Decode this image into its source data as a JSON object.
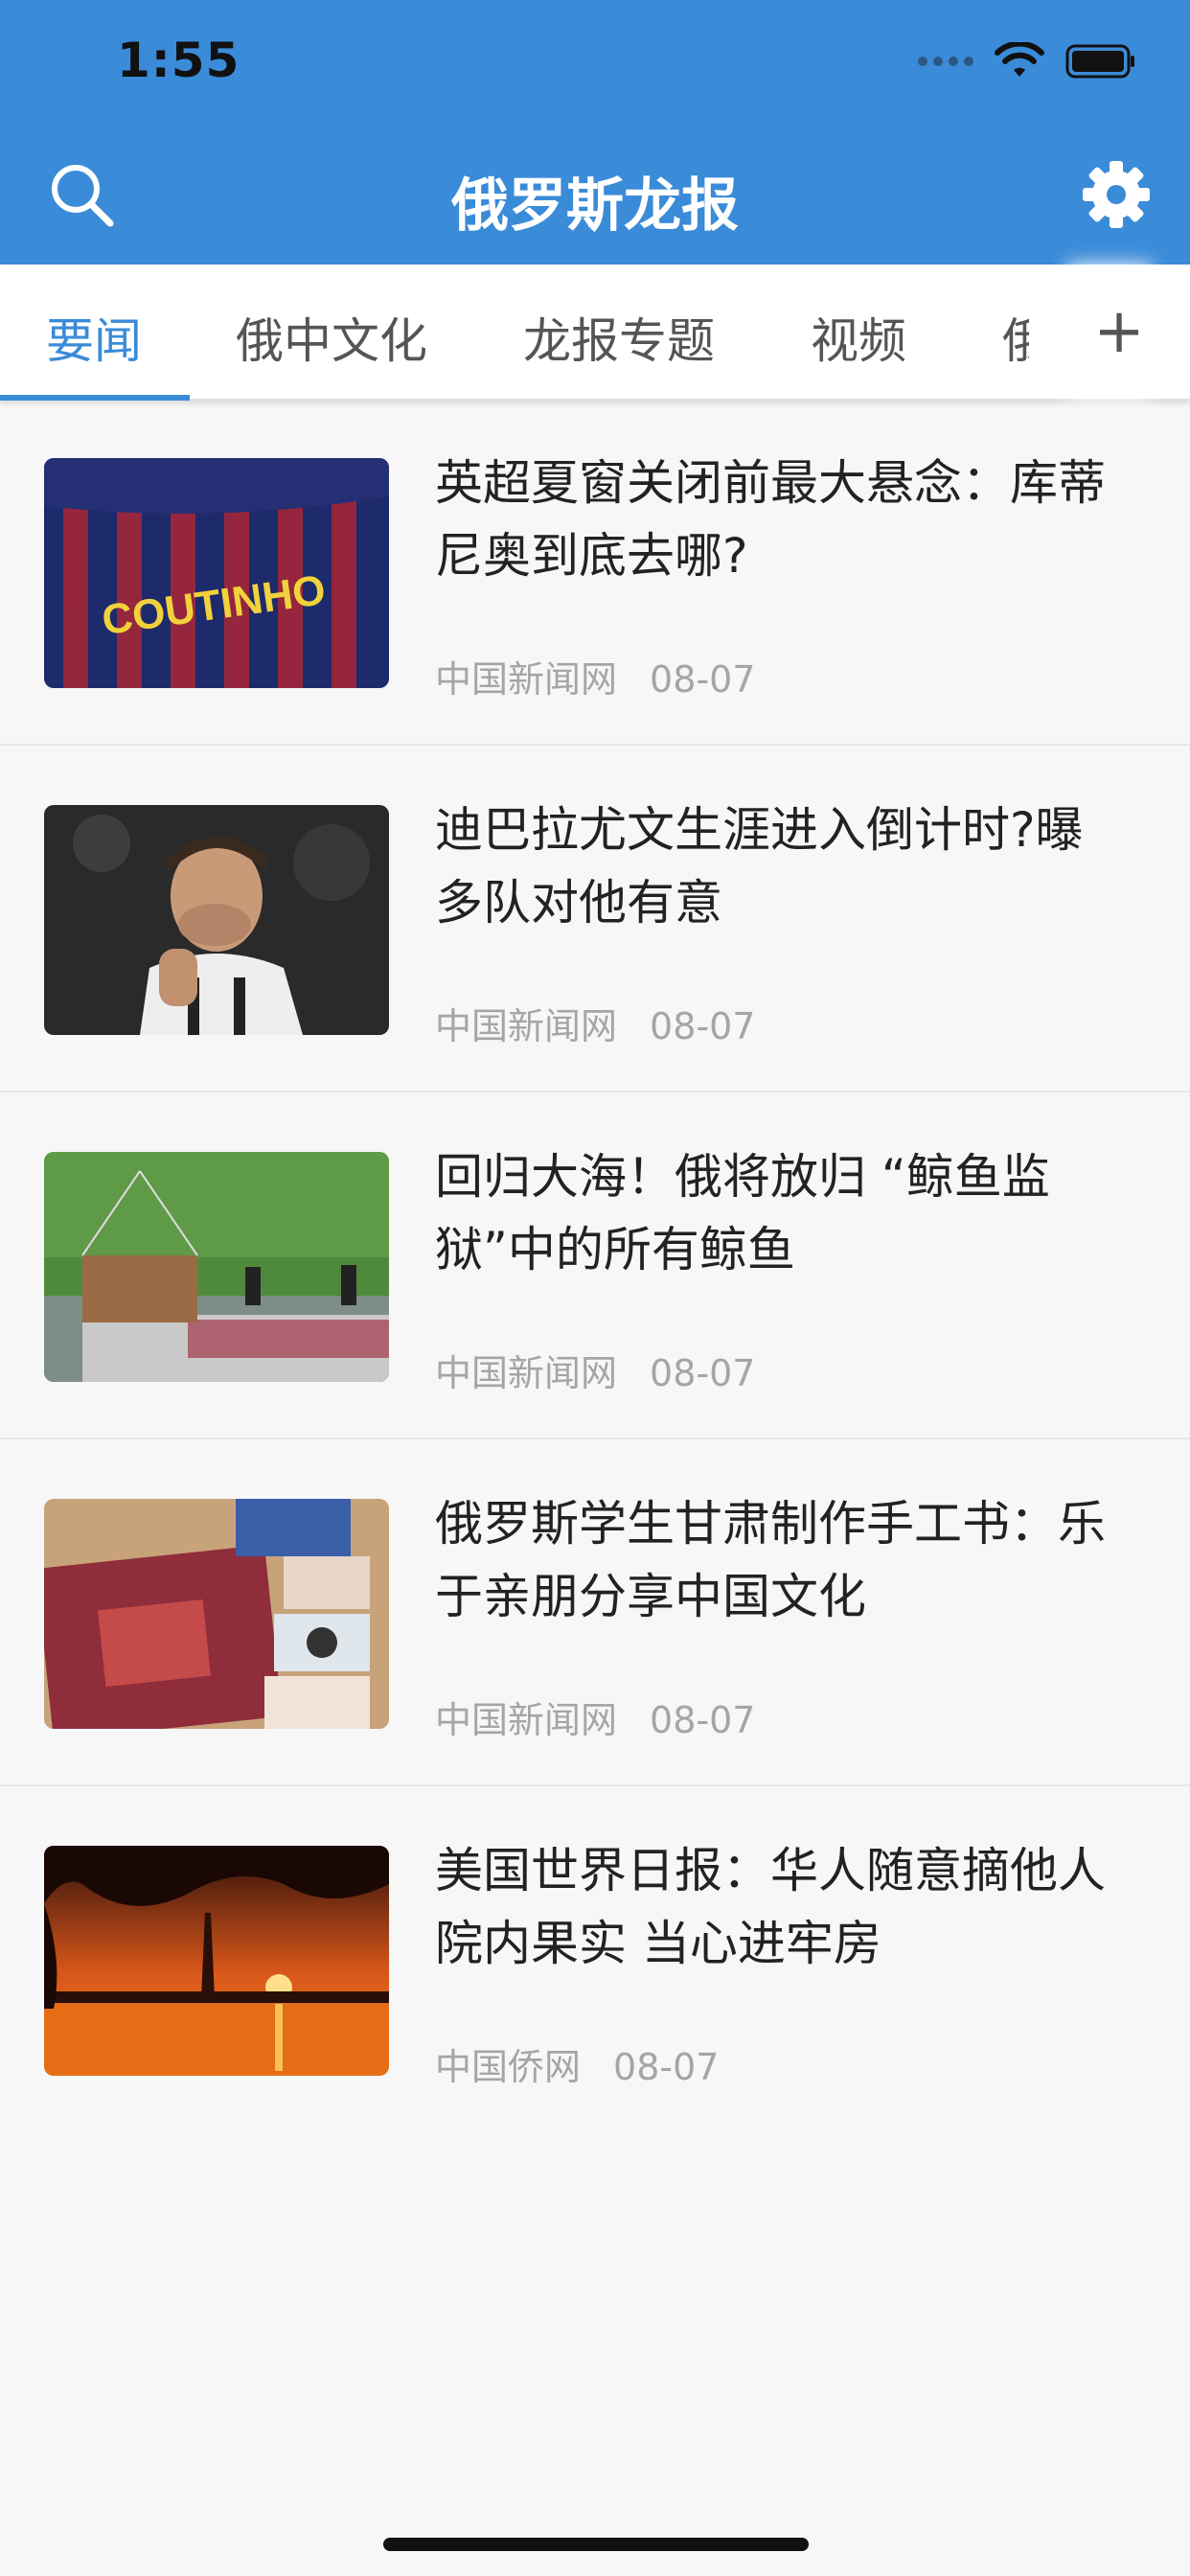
{
  "status_bar": {
    "time": "1:55"
  },
  "header": {
    "title": "俄罗斯龙报"
  },
  "tabs": [
    {
      "label": "要闻"
    },
    {
      "label": "俄中文化"
    },
    {
      "label": "龙报专题"
    },
    {
      "label": "视频"
    },
    {
      "label": "俄"
    }
  ],
  "add_tab_label": "+",
  "articles": [
    {
      "title": "英超夏窗关闭前最大悬念：库蒂尼奥到底去哪?",
      "source": "中国新闻网",
      "date": "08-07"
    },
    {
      "title": "迪巴拉尤文生涯进入倒计时?曝多队对他有意",
      "source": "中国新闻网",
      "date": "08-07"
    },
    {
      "title": "回归大海！俄将放归 “鲸鱼监狱”中的所有鲸鱼",
      "source": "中国新闻网",
      "date": "08-07"
    },
    {
      "title": "俄罗斯学生甘肃制作手工书：乐于亲朋分享中国文化",
      "source": "中国新闻网",
      "date": "08-07"
    },
    {
      "title": "美国世界日报：华人随意摘他人院内果实 当心进牢房",
      "source": "中国侨网",
      "date": "08-07"
    }
  ],
  "thumb_text": {
    "jersey": "COUTINHO"
  },
  "colors": {
    "accent": "#3a8bd8",
    "meta": "#a5a5a5"
  }
}
